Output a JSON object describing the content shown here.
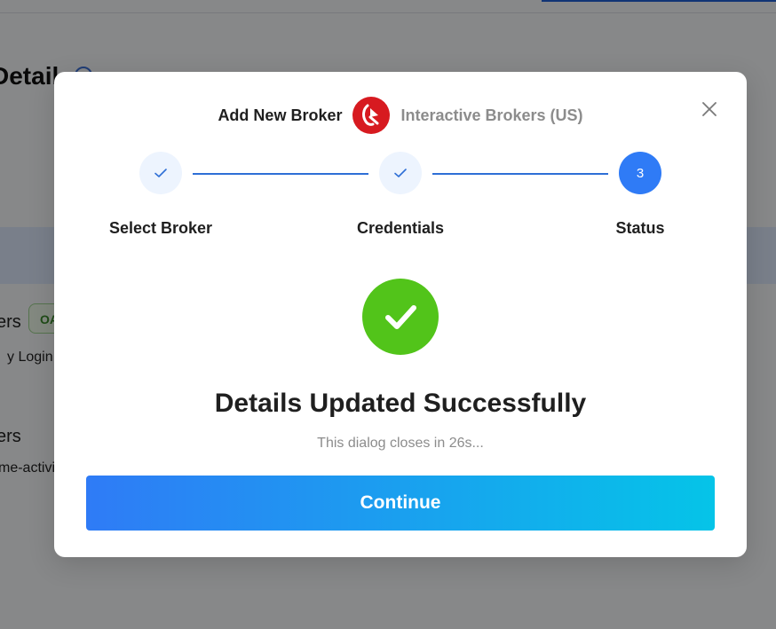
{
  "background": {
    "page_title": "Detail",
    "section_1_title": "ers",
    "section_1_badge": "OA",
    "section_1_sub": "y Login",
    "section_2_title": "ers",
    "section_2_sub": "me-activit"
  },
  "modal": {
    "header_title": "Add New Broker",
    "broker_name": "Interactive Brokers (US)",
    "broker_logo_icon": "interactive-brokers-logo",
    "steps": [
      {
        "label": "Select Broker",
        "state": "done"
      },
      {
        "label": "Credentials",
        "state": "done"
      },
      {
        "label": "Status",
        "state": "active",
        "number": "3"
      }
    ],
    "success_title": "Details Updated Successfully",
    "countdown_text": "This dialog closes in 26s...",
    "continue_label": "Continue",
    "colors": {
      "accent": "#2f7bf6",
      "gradient_end": "#05c4e8",
      "success": "#52c41a",
      "logo": "#d71a20"
    }
  }
}
